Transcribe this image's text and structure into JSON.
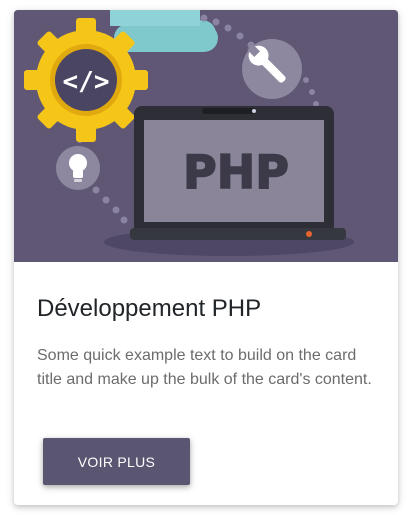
{
  "card": {
    "title": "Développement PHP",
    "text": "Some quick example text to build on the card title and make up the bulk of the card's content.",
    "button_label": "VOIR PLUS"
  },
  "image": {
    "screen_text": "PHP",
    "gear_text": "</>",
    "icons": [
      "gear-code-icon",
      "cloud-icon",
      "wrench-icon",
      "lightbulb-icon",
      "laptop-icon"
    ]
  },
  "colors": {
    "image_background": "#5f5774",
    "button": "#5a5570",
    "gear": "#f5c518",
    "cloud": "#7fc8cc"
  }
}
